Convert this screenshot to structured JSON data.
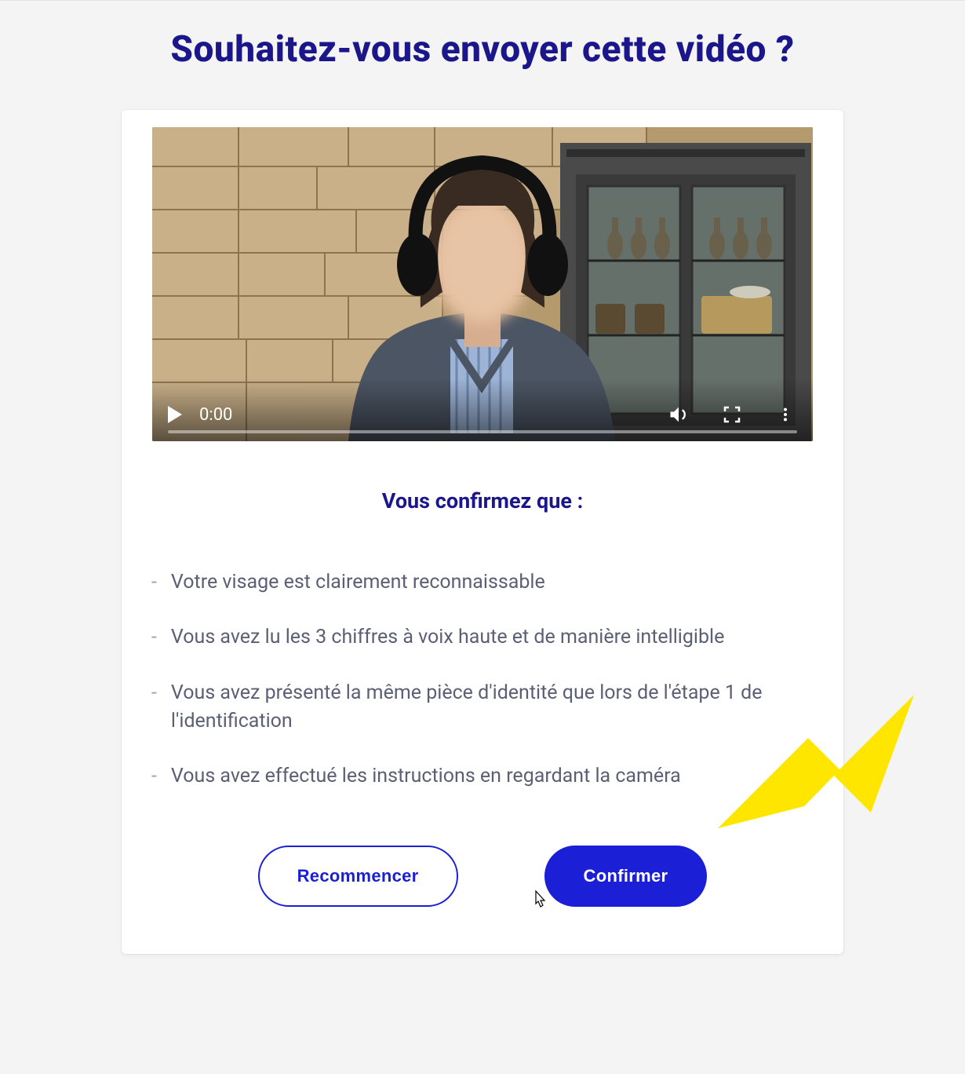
{
  "title": "Souhaitez-vous envoyer cette vidéo ?",
  "video": {
    "time": "0:00"
  },
  "subheading": "Vous confirmez que :",
  "checklist": [
    "Votre visage est clairement reconnaissable",
    "Vous avez lu les 3 chiffres à voix haute et de manière intelligible",
    "Vous avez présenté la même pièce d'identité que lors de l'étape 1 de l'identification",
    "Vous avez effectué les instructions en regardant la caméra"
  ],
  "buttons": {
    "restart": "Recommencer",
    "confirm": "Confirmer"
  },
  "colors": {
    "accent": "#1b1fd6",
    "heading": "#1b168a",
    "arrow": "#ffe600"
  }
}
